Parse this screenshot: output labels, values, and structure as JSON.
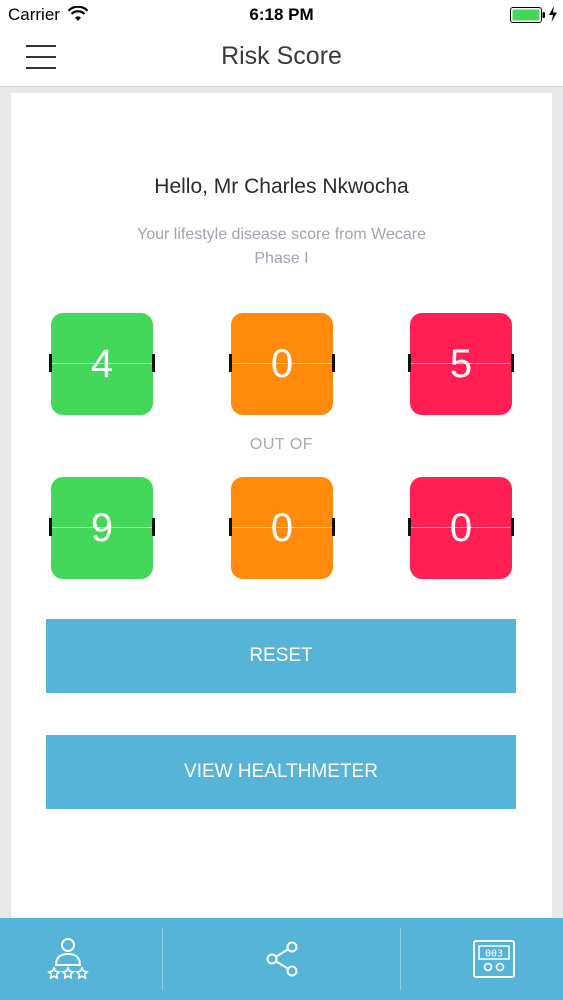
{
  "status_bar": {
    "carrier": "Carrier",
    "time": "6:18 PM",
    "wifi_icon": "wifi-icon",
    "battery_icon": "battery-icon",
    "battery_color": "#44d85a"
  },
  "nav": {
    "title": "Risk Score",
    "menu_icon": "hamburger-menu-icon"
  },
  "greeting": "Hello, Mr Charles Nkwocha",
  "subtitle_line1": "Your lifestyle disease score from Wecare",
  "subtitle_line2": "Phase I",
  "score": {
    "digits": [
      "4",
      "0",
      "5"
    ],
    "value": 405
  },
  "out_of_label": "OUT OF",
  "max_score": {
    "digits": [
      "9",
      "0",
      "0"
    ],
    "value": 900
  },
  "tile_colors": [
    "#44d85a",
    "#ff8a0c",
    "#ff1f52"
  ],
  "buttons": {
    "reset": "RESET",
    "view_healthmeter": "VIEW HEALTHMETER"
  },
  "accent_color": "#55b4d8",
  "tab_bar": {
    "tabs": [
      {
        "icon": "user-rating-icon"
      },
      {
        "icon": "share-icon"
      },
      {
        "icon": "score-meter-icon"
      }
    ]
  }
}
